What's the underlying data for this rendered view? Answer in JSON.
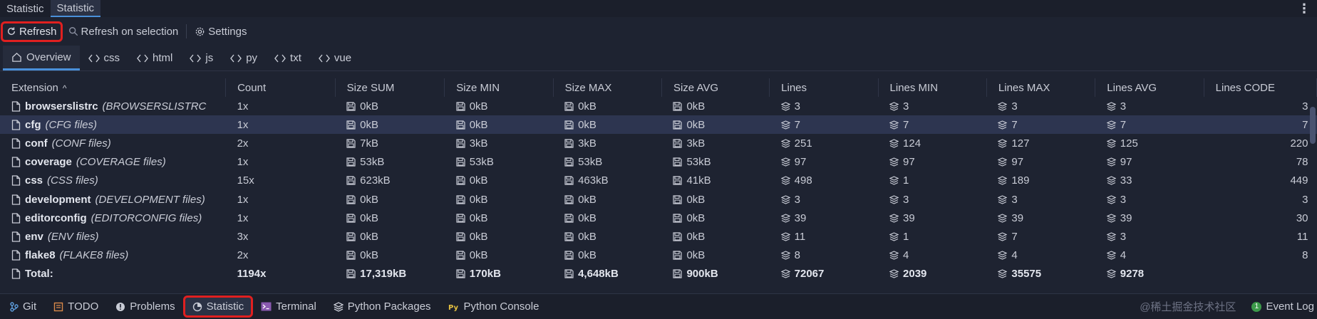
{
  "header": {
    "tabs": [
      {
        "label": "Statistic",
        "active": false
      },
      {
        "label": "Statistic",
        "active": true
      }
    ]
  },
  "toolbar": {
    "refresh_label": "Refresh",
    "refresh_on_selection_label": "Refresh on selection",
    "settings_label": "Settings"
  },
  "ext_tabs": [
    {
      "label": "Overview",
      "icon": "home-icon",
      "active": true
    },
    {
      "label": "css",
      "icon": "code-icon"
    },
    {
      "label": "html",
      "icon": "code-icon"
    },
    {
      "label": "js",
      "icon": "code-icon"
    },
    {
      "label": "py",
      "icon": "code-icon"
    },
    {
      "label": "txt",
      "icon": "code-icon"
    },
    {
      "label": "vue",
      "icon": "code-icon"
    }
  ],
  "table": {
    "columns": [
      "Extension",
      "Count",
      "Size SUM",
      "Size MIN",
      "Size MAX",
      "Size AVG",
      "Lines",
      "Lines MIN",
      "Lines MAX",
      "Lines AVG",
      "Lines CODE"
    ],
    "sort_indicator": "^",
    "rows": [
      {
        "ext": "browserslistrc",
        "desc": "(BROWSERSLISTRC",
        "count": "1x",
        "size_sum": "0kB",
        "size_min": "0kB",
        "size_max": "0kB",
        "size_avg": "0kB",
        "lines": "3",
        "lines_min": "3",
        "lines_max": "3",
        "lines_avg": "3",
        "lines_code": "3"
      },
      {
        "ext": "cfg",
        "desc": "(CFG files)",
        "count": "1x",
        "size_sum": "0kB",
        "size_min": "0kB",
        "size_max": "0kB",
        "size_avg": "0kB",
        "lines": "7",
        "lines_min": "7",
        "lines_max": "7",
        "lines_avg": "7",
        "lines_code": "7",
        "selected": true
      },
      {
        "ext": "conf",
        "desc": "(CONF files)",
        "count": "2x",
        "size_sum": "7kB",
        "size_min": "3kB",
        "size_max": "3kB",
        "size_avg": "3kB",
        "lines": "251",
        "lines_min": "124",
        "lines_max": "127",
        "lines_avg": "125",
        "lines_code": "220"
      },
      {
        "ext": "coverage",
        "desc": "(COVERAGE files)",
        "count": "1x",
        "size_sum": "53kB",
        "size_min": "53kB",
        "size_max": "53kB",
        "size_avg": "53kB",
        "lines": "97",
        "lines_min": "97",
        "lines_max": "97",
        "lines_avg": "97",
        "lines_code": "78"
      },
      {
        "ext": "css",
        "desc": "(CSS files)",
        "count": "15x",
        "size_sum": "623kB",
        "size_min": "0kB",
        "size_max": "463kB",
        "size_avg": "41kB",
        "lines": "498",
        "lines_min": "1",
        "lines_max": "189",
        "lines_avg": "33",
        "lines_code": "449"
      },
      {
        "ext": "development",
        "desc": "(DEVELOPMENT files)",
        "count": "1x",
        "size_sum": "0kB",
        "size_min": "0kB",
        "size_max": "0kB",
        "size_avg": "0kB",
        "lines": "3",
        "lines_min": "3",
        "lines_max": "3",
        "lines_avg": "3",
        "lines_code": "3"
      },
      {
        "ext": "editorconfig",
        "desc": "(EDITORCONFIG files)",
        "count": "1x",
        "size_sum": "0kB",
        "size_min": "0kB",
        "size_max": "0kB",
        "size_avg": "0kB",
        "lines": "39",
        "lines_min": "39",
        "lines_max": "39",
        "lines_avg": "39",
        "lines_code": "30"
      },
      {
        "ext": "env",
        "desc": "(ENV files)",
        "count": "3x",
        "size_sum": "0kB",
        "size_min": "0kB",
        "size_max": "0kB",
        "size_avg": "0kB",
        "lines": "11",
        "lines_min": "1",
        "lines_max": "7",
        "lines_avg": "3",
        "lines_code": "11"
      },
      {
        "ext": "flake8",
        "desc": "(FLAKE8 files)",
        "count": "2x",
        "size_sum": "0kB",
        "size_min": "0kB",
        "size_max": "0kB",
        "size_avg": "0kB",
        "lines": "8",
        "lines_min": "4",
        "lines_max": "4",
        "lines_avg": "4",
        "lines_code": "8"
      }
    ],
    "total": {
      "label": "Total:",
      "count": "1194x",
      "size_sum": "17,319kB",
      "size_min": "170kB",
      "size_max": "4,648kB",
      "size_avg": "900kB",
      "lines": "72067",
      "lines_min": "2039",
      "lines_max": "35575",
      "lines_avg": "9278"
    }
  },
  "status_bar": {
    "items": [
      {
        "label": "Git",
        "icon": "git-icon"
      },
      {
        "label": "TODO",
        "icon": "todo-icon"
      },
      {
        "label": "Problems",
        "icon": "problems-icon"
      },
      {
        "label": "Statistic",
        "icon": "statistic-icon",
        "highlight": true
      },
      {
        "label": "Terminal",
        "icon": "terminal-icon"
      },
      {
        "label": "Python Packages",
        "icon": "python-packages-icon"
      },
      {
        "label": "Python Console",
        "icon": "python-console-icon"
      }
    ],
    "watermark": "@稀土掘金技术社区",
    "event_log_label": "Event Log",
    "event_badge": "1"
  },
  "colors": {
    "background": "#1e2331",
    "accent": "#4a90d9",
    "highlight_red": "#e02020",
    "selected_row": "#2d3550"
  }
}
